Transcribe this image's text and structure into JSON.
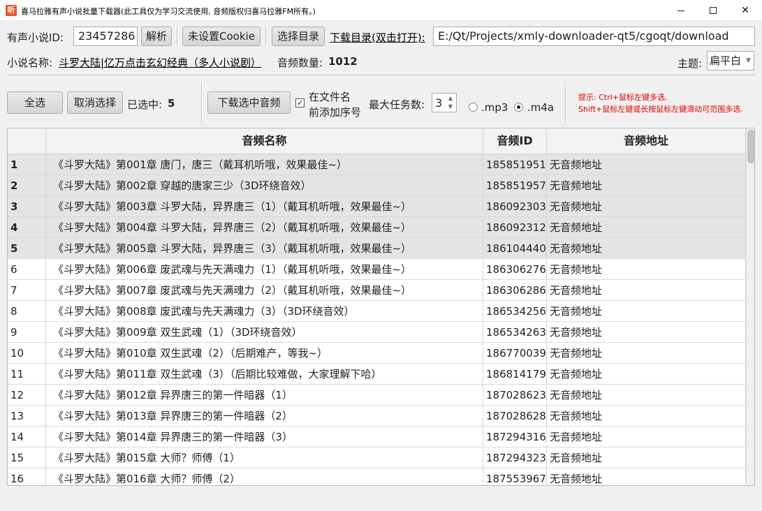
{
  "window": {
    "icon_text": "听",
    "title": "喜马拉雅有声小说批量下载器(此工具仅为学习交流使用, 音频版权归喜马拉雅FM所有。)"
  },
  "top": {
    "novel_id_label": "有声小说ID:",
    "novel_id_value": "23457286",
    "parse_button": "解析",
    "cookie_button": "未设置Cookie",
    "choose_dir_button": "选择目录",
    "download_dir_link": "下载目录(双击打开):",
    "download_dir_value": "E:/Qt/Projects/xmly-downloader-qt5/cgoqt/download",
    "novel_name_label": "小说名称:",
    "novel_name_value": "斗罗大陆|亿万点击玄幻经典（多人小说剧）",
    "audio_count_label": "音频数量:",
    "audio_count_value": "1012",
    "theme_label": "主题:",
    "theme_value": "扁平白"
  },
  "toolbar": {
    "select_all": "全选",
    "deselect": "取消选择",
    "selected_label": "已选中:",
    "selected_count": "5",
    "download_selected": "下载选中音频",
    "prefix_line1": "在文件名",
    "prefix_line2": "前添加序号",
    "prefix_checked": true,
    "max_tasks_label": "最大任务数:",
    "max_tasks_value": "3",
    "fmt_mp3": ".mp3",
    "fmt_m4a": ".m4a",
    "fmt_selected": ".m4a",
    "hint_line1": "提示: Ctrl+鼠标左键多选.",
    "hint_line2": "Shift+鼠标左键或长按鼠标左键滑动可范围多选."
  },
  "table": {
    "headers": {
      "index": "",
      "name": "音频名称",
      "id": "音频ID",
      "url": "音频地址"
    },
    "rows": [
      {
        "idx": "1",
        "name": "《斗罗大陆》第001章 唐门，唐三（戴耳机听哦，效果最佳~）",
        "id": "185851951",
        "url": "无音频地址",
        "selected": true
      },
      {
        "idx": "2",
        "name": "《斗罗大陆》第002章 穿越的唐家三少（3D环绕音效）",
        "id": "185851957",
        "url": "无音频地址",
        "selected": true
      },
      {
        "idx": "3",
        "name": "《斗罗大陆》第003章 斗罗大陆，异界唐三（1）（戴耳机听哦，效果最佳~）",
        "id": "186092303",
        "url": "无音频地址",
        "selected": true
      },
      {
        "idx": "4",
        "name": "《斗罗大陆》第004章 斗罗大陆，异界唐三（2）（戴耳机听哦，效果最佳~）",
        "id": "186092312",
        "url": "无音频地址",
        "selected": true
      },
      {
        "idx": "5",
        "name": "《斗罗大陆》第005章 斗罗大陆，异界唐三（3）（戴耳机听哦，效果最佳~）",
        "id": "186104440",
        "url": "无音频地址",
        "selected": true
      },
      {
        "idx": "6",
        "name": "《斗罗大陆》第006章 废武魂与先天满魂力（1）（戴耳机听哦，效果最佳~）",
        "id": "186306276",
        "url": "无音频地址",
        "selected": false
      },
      {
        "idx": "7",
        "name": "《斗罗大陆》第007章 废武魂与先天满魂力（2）（戴耳机听哦，效果最佳~）",
        "id": "186306286",
        "url": "无音频地址",
        "selected": false
      },
      {
        "idx": "8",
        "name": "《斗罗大陆》第008章 废武魂与先天满魂力（3）（3D环绕音效）",
        "id": "186534256",
        "url": "无音频地址",
        "selected": false
      },
      {
        "idx": "9",
        "name": "《斗罗大陆》第009章 双生武魂（1）（3D环绕音效）",
        "id": "186534263",
        "url": "无音频地址",
        "selected": false
      },
      {
        "idx": "10",
        "name": "《斗罗大陆》第010章 双生武魂（2）（后期难产，等我~）",
        "id": "186770039",
        "url": "无音频地址",
        "selected": false
      },
      {
        "idx": "11",
        "name": "《斗罗大陆》第011章 双生武魂（3）（后期比较难做，大家理解下哈）",
        "id": "186814179",
        "url": "无音频地址",
        "selected": false
      },
      {
        "idx": "12",
        "name": "《斗罗大陆》第012章 异界唐三的第一件暗器（1）",
        "id": "187028623",
        "url": "无音频地址",
        "selected": false
      },
      {
        "idx": "13",
        "name": "《斗罗大陆》第013章 异界唐三的第一件暗器（2）",
        "id": "187028628",
        "url": "无音频地址",
        "selected": false
      },
      {
        "idx": "14",
        "name": "《斗罗大陆》第014章 异界唐三的第一件暗器（3）",
        "id": "187294316",
        "url": "无音频地址",
        "selected": false
      },
      {
        "idx": "15",
        "name": "《斗罗大陆》第015章 大师？师傅（1）",
        "id": "187294323",
        "url": "无音频地址",
        "selected": false
      },
      {
        "idx": "16",
        "name": "《斗罗大陆》第016章 大师？师傅（2）",
        "id": "187553967",
        "url": "无音频地址",
        "selected": false
      }
    ]
  }
}
